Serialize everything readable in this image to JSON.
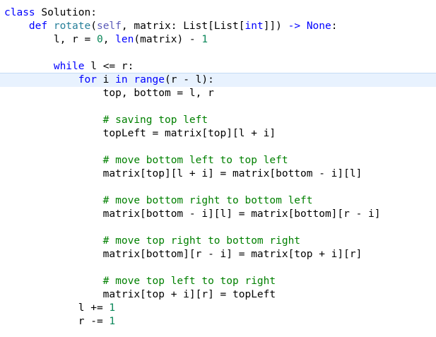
{
  "editor": {
    "lines": [
      {
        "tokens": [
          {
            "t": "class",
            "c": "kw"
          },
          {
            "t": " Solution:",
            "c": "pl"
          }
        ]
      },
      {
        "tokens": [
          {
            "t": "    def",
            "c": "kw"
          },
          {
            "t": " ",
            "c": "pl"
          },
          {
            "t": "rotate",
            "c": "fn"
          },
          {
            "t": "(",
            "c": "pl"
          },
          {
            "t": "self",
            "c": "sf"
          },
          {
            "t": ", matrix: List[List[",
            "c": "pl"
          },
          {
            "t": "int",
            "c": "ty2"
          },
          {
            "t": "]]) ",
            "c": "pl"
          },
          {
            "t": "->",
            "c": "ar"
          },
          {
            "t": " ",
            "c": "pl"
          },
          {
            "t": "None",
            "c": "kw"
          },
          {
            "t": ":",
            "c": "pl"
          }
        ]
      },
      {
        "tokens": [
          {
            "t": "        l, r = ",
            "c": "pl"
          },
          {
            "t": "0",
            "c": "nu"
          },
          {
            "t": ", ",
            "c": "pl"
          },
          {
            "t": "len",
            "c": "ty2"
          },
          {
            "t": "(matrix) - ",
            "c": "pl"
          },
          {
            "t": "1",
            "c": "nu"
          }
        ]
      },
      {
        "tokens": []
      },
      {
        "tokens": [
          {
            "t": "        while",
            "c": "kw"
          },
          {
            "t": " l <= r:",
            "c": "pl"
          }
        ]
      },
      {
        "tokens": [
          {
            "t": "            for",
            "c": "kw"
          },
          {
            "t": " i ",
            "c": "pl"
          },
          {
            "t": "in",
            "c": "kw"
          },
          {
            "t": " ",
            "c": "pl"
          },
          {
            "t": "range",
            "c": "ty2"
          },
          {
            "t": "(r - l):",
            "c": "pl"
          }
        ]
      },
      {
        "tokens": [
          {
            "t": "                top, bottom = l, r",
            "c": "pl"
          }
        ]
      },
      {
        "tokens": []
      },
      {
        "tokens": [
          {
            "t": "                # saving top left",
            "c": "cm"
          }
        ]
      },
      {
        "tokens": [
          {
            "t": "                topLeft = matrix[top][l + i]",
            "c": "pl"
          }
        ]
      },
      {
        "tokens": []
      },
      {
        "tokens": [
          {
            "t": "                # move bottom left to top left",
            "c": "cm"
          }
        ]
      },
      {
        "tokens": [
          {
            "t": "                matrix[top][l + i] = matrix[bottom - i][l]",
            "c": "pl"
          }
        ]
      },
      {
        "tokens": []
      },
      {
        "tokens": [
          {
            "t": "                # move bottom right to bottom left",
            "c": "cm"
          }
        ]
      },
      {
        "tokens": [
          {
            "t": "                matrix[bottom - i][l] = matrix[bottom][r - i]",
            "c": "pl"
          }
        ]
      },
      {
        "tokens": []
      },
      {
        "tokens": [
          {
            "t": "                # move top right to bottom right",
            "c": "cm"
          }
        ]
      },
      {
        "tokens": [
          {
            "t": "                matrix[bottom][r - i] = matrix[top + i][r]",
            "c": "pl"
          }
        ]
      },
      {
        "tokens": []
      },
      {
        "tokens": [
          {
            "t": "                # move top left to top right",
            "c": "cm"
          }
        ]
      },
      {
        "tokens": [
          {
            "t": "                matrix[top + i][r] = topLeft",
            "c": "pl"
          }
        ]
      },
      {
        "tokens": [
          {
            "t": "            l += ",
            "c": "pl"
          },
          {
            "t": "1",
            "c": "nu"
          }
        ]
      },
      {
        "tokens": [
          {
            "t": "            r -= ",
            "c": "pl"
          },
          {
            "t": "1",
            "c": "nu"
          }
        ]
      }
    ],
    "current_line_index": 5,
    "colors": {
      "keyword": "#0000ff",
      "function": "#267f99",
      "comment": "#008000",
      "number": "#098658",
      "self": "#5a5ab8",
      "current_line_bg": "#e8f2fe"
    }
  }
}
